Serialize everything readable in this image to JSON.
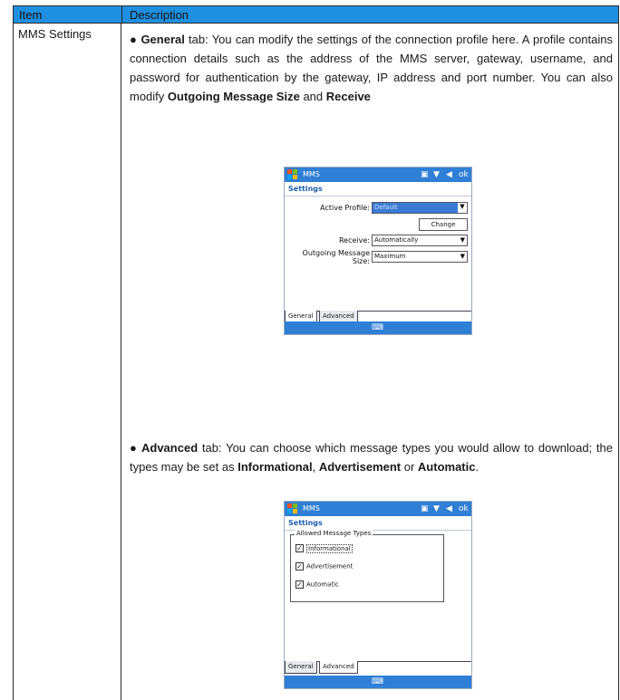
{
  "table": {
    "header": {
      "item": "Item",
      "description": "Description"
    },
    "row": {
      "item": "MMS Settings"
    }
  },
  "general": {
    "bullet": "●",
    "tab_name": "General",
    "text_a": " tab: You can modify the settings of the connection profile here. A profile contains connection details such as the address of the MMS server, gateway, username, and password for authentication by the gateway, IP address and port number. You can also modify ",
    "bold_1": "Outgoing Message Size",
    "text_b": " and ",
    "bold_2": "Receive"
  },
  "advanced": {
    "bullet": "●",
    "tab_name": "Advanced",
    "text_a": " tab: You can choose which message types you would allow to download; the types may be set as ",
    "bold_1": "Informational",
    "text_b": ", ",
    "bold_2": "Advertisement",
    "text_c": " or ",
    "bold_3": "Automatic",
    "text_d": "."
  },
  "phone1": {
    "app": "MMS",
    "header": "Settings",
    "active_profile_label": "Active Profile:",
    "active_profile_value": "Default",
    "change_button": "Change",
    "receive_label": "Receive:",
    "receive_value": "Automatically",
    "outgoing_label_1": "Outgoing Message",
    "outgoing_label_2": "Size:",
    "outgoing_value": "Maximum",
    "tab_general": "General",
    "tab_advanced": "Advanced"
  },
  "phone2": {
    "app": "MMS",
    "header": "Settings",
    "group_title": "Allowed Message Types",
    "options": [
      "Informational",
      "Advertisement",
      "Automatic"
    ],
    "tab_general": "General",
    "tab_advanced": "Advanced"
  },
  "colors": {
    "header_bg": "#1f8fe0",
    "title_bar": "#2f7fd6"
  }
}
